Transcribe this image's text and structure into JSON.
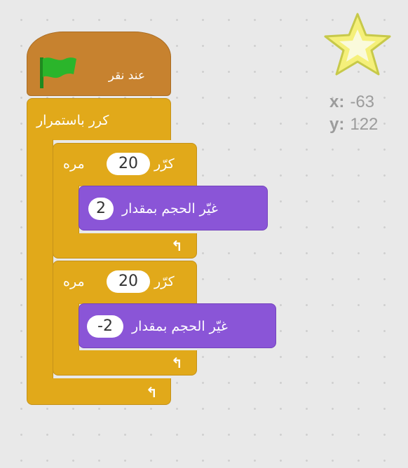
{
  "hat_block": {
    "label": "عند نقر",
    "icon": "green-flag-icon"
  },
  "forever_block": {
    "label": "كرر باستمرار"
  },
  "repeat_blocks": [
    {
      "prefix": "كرّر",
      "count": "20",
      "suffix": "مره",
      "inner": {
        "label": "غيّر الحجم بمقدار",
        "value": "2"
      }
    },
    {
      "prefix": "كرّر",
      "count": "20",
      "suffix": "مره",
      "inner": {
        "label": "غيّر الحجم بمقدار",
        "value": "-2"
      }
    }
  ],
  "sprite": {
    "icon": "star-icon",
    "x_label": "x:",
    "x_value": "-63",
    "y_label": "y:",
    "y_value": "122"
  },
  "colors": {
    "control": "#e1a91a",
    "events": "#c7822f",
    "looks": "#8a55d7",
    "flag": "#2bb52b",
    "star": "#f5f07a"
  }
}
